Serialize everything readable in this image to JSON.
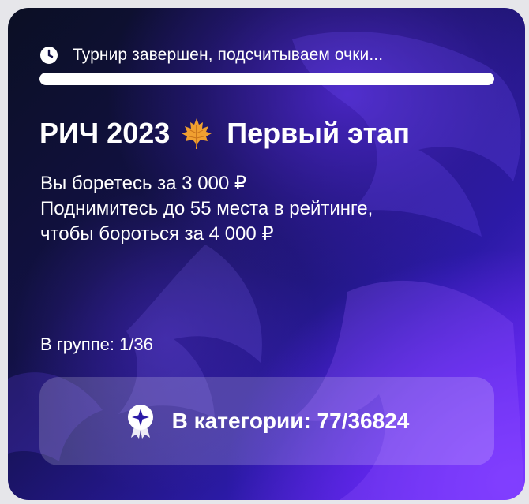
{
  "status": {
    "icon": "clock-icon",
    "text": "Турнир завершен, подсчитываем очки...",
    "progress_fraction": 1.0
  },
  "title": {
    "part1": "РИЧ 2023",
    "icon": "maple-leaf-icon",
    "part2": "Первый этап"
  },
  "description": {
    "line1": "Вы боретесь за 3 000 ₽",
    "line2": "Поднимитесь до 55 места в рейтинге,",
    "line3": "чтобы бороться за 4 000 ₽"
  },
  "group": {
    "text": "В группе: 1/36"
  },
  "category": {
    "icon": "badge-star-icon",
    "text": "В категории: 77/36824"
  },
  "colors": {
    "accent": "#6a2cf5",
    "background_dark": "#0b0f24",
    "text": "#ffffff",
    "maple_leaf": "#f0a030"
  }
}
